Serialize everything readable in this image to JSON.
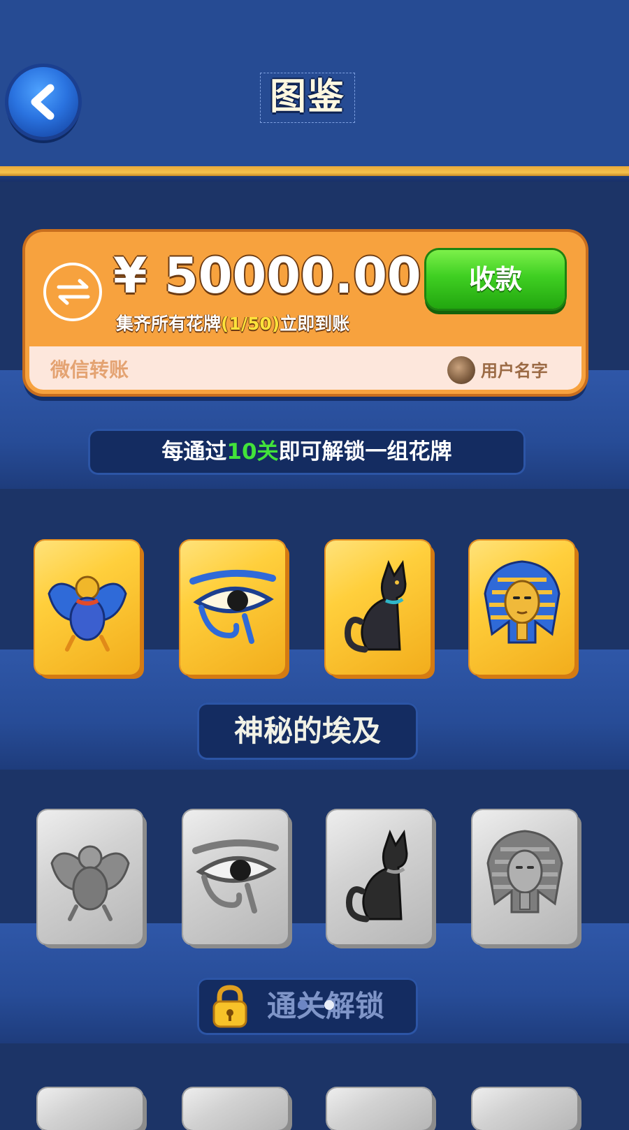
{
  "header": {
    "title": "图鉴",
    "back_icon": "chevron-left-icon"
  },
  "transfer_card": {
    "amount": "¥ 50000.00",
    "subtitle_prefix": "集齐所有花牌",
    "progress": "(1/50)",
    "subtitle_suffix": "立即到账",
    "collect_label": "收款",
    "wechat_label": "微信转账",
    "user_name": "用户名字",
    "swap_icon": "swap-arrows-icon"
  },
  "info": {
    "prefix": "每通过",
    "highlight": "10关",
    "suffix": "即可解锁一组花牌"
  },
  "collections": [
    {
      "name": "神秘的埃及",
      "unlocked": true,
      "tiles": [
        "scarab-icon",
        "eye-of-horus-icon",
        "egyptian-cat-icon",
        "pharaoh-icon"
      ]
    },
    {
      "name": "通关解锁",
      "unlocked": false,
      "tiles": [
        "scarab-icon",
        "eye-of-horus-icon",
        "egyptian-cat-icon",
        "pharaoh-icon"
      ]
    }
  ],
  "colors": {
    "header": "#264b93",
    "card": "#f7a23e",
    "collect_button": "#3fcf22",
    "highlight_green": "#42e33a",
    "highlight_yellow": "#ffe23a"
  }
}
